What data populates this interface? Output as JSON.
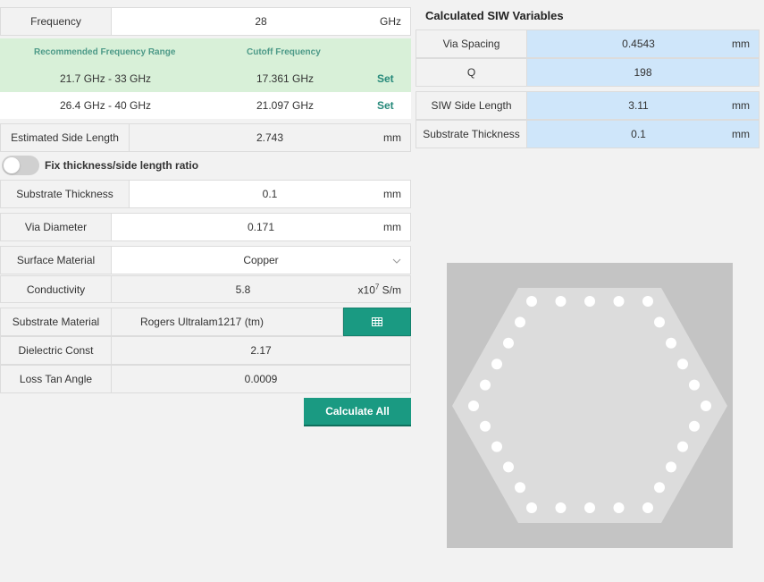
{
  "frequency": {
    "label": "Frequency",
    "value": "28",
    "unit": "GHz"
  },
  "freq_table": {
    "col_range": "Recommended Frequency Range",
    "col_cutoff": "Cutoff Frequency",
    "rows": [
      {
        "range": "21.7 GHz - 33 GHz",
        "cutoff": "17.361 GHz",
        "action": "Set"
      },
      {
        "range": "26.4 GHz - 40 GHz",
        "cutoff": "21.097 GHz",
        "action": "Set"
      }
    ]
  },
  "estimated_side_length": {
    "label": "Estimated Side Length",
    "value": "2.743",
    "unit": "mm"
  },
  "ratio_toggle": {
    "label": "Fix thickness/side length ratio",
    "on": false
  },
  "substrate_thickness": {
    "label": "Substrate Thickness",
    "value": "0.1",
    "unit": "mm"
  },
  "via_diameter": {
    "label": "Via Diameter",
    "value": "0.171",
    "unit": "mm"
  },
  "surface_material": {
    "label": "Surface Material",
    "value": "Copper"
  },
  "conductivity": {
    "label": "Conductivity",
    "value": "5.8",
    "unit_base": "x10",
    "unit_exp": "7",
    "unit_tail": " S/m"
  },
  "substrate_material": {
    "label": "Substrate Material",
    "value": "Rogers Ultralam1217 (tm)"
  },
  "dielectric_const": {
    "label": "Dielectric Const",
    "value": "2.17"
  },
  "loss_tan": {
    "label": "Loss Tan Angle",
    "value": "0.0009"
  },
  "calculate_label": "Calculate All",
  "results": {
    "title": "Calculated SIW Variables",
    "via_spacing": {
      "label": "Via Spacing",
      "value": "0.4543",
      "unit": "mm"
    },
    "q": {
      "label": "Q",
      "value": "198"
    },
    "siw_side_length": {
      "label": "SIW Side Length",
      "value": "3.11",
      "unit": "mm"
    },
    "substrate_thickness": {
      "label": "Substrate Thickness",
      "value": "0.1",
      "unit": "mm"
    }
  },
  "colors": {
    "accent": "#1a9a82",
    "result_bg": "#cfe6fa",
    "recommended_bg": "#d8f0d8",
    "preview_bg": "#c4c4c4",
    "hexagon": "#dcdcdc"
  },
  "icons": {
    "table": "table-icon",
    "dropdown": "chevron-down-icon"
  }
}
